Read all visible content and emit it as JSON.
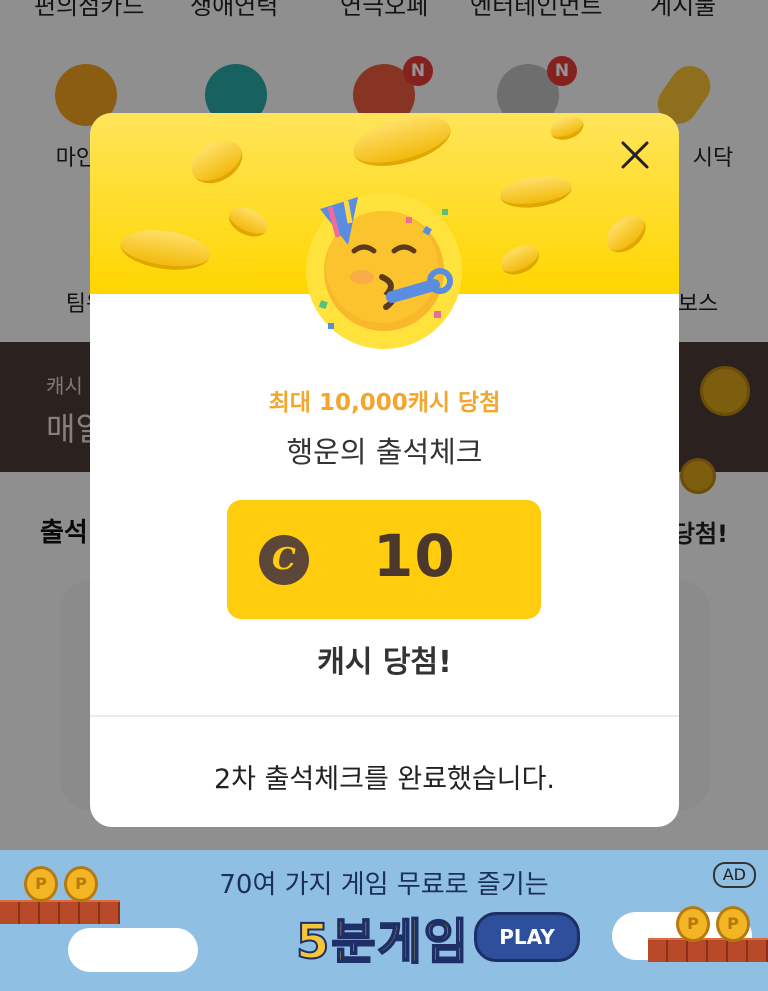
{
  "background": {
    "top_menu": [
      "편의점카드",
      "생애연력",
      "연극오페",
      "엔터테인먼트",
      "게시물"
    ],
    "icon_tiles": [
      {
        "label": "마인드",
        "icon": "heart-info-icon",
        "badge": ""
      },
      {
        "label": "",
        "icon": "s-logo-icon",
        "badge": ""
      },
      {
        "label": "",
        "icon": "paw-cash-icon",
        "badge": "N"
      },
      {
        "label": "",
        "icon": "runner-icon",
        "badge": "N"
      },
      {
        "label": "시닥",
        "icon": "pill-icon",
        "badge": ""
      }
    ],
    "second_row": [
      {
        "label": "팀워"
      },
      {
        "label": "보스"
      }
    ],
    "banner": {
      "small": "캐시",
      "big": "매일"
    },
    "attendance_title": "출석",
    "attendance_right": "당첨!"
  },
  "ad": {
    "tagline": "70여 가지 게임 무료로 즐기는",
    "game_name": "5분게임",
    "play_label": "PLAY",
    "badge": "AD",
    "coin_glyph": "P"
  },
  "modal": {
    "close_icon": "close-icon",
    "emoji": "party-face-emoji",
    "subtitle": "최대 10,000캐시 당첨",
    "title": "행운의 출석체크",
    "prize": {
      "currency_glyph": "C",
      "amount": "10"
    },
    "won_text": "캐시 당첨!",
    "completion_message": "2차 출석체크를 완료했습니다."
  },
  "colors": {
    "header_yellow": "#ffd600",
    "prize_yellow": "#ffcc0e",
    "accent_orange": "#f4a52c",
    "coin_brown": "#5c4637"
  }
}
